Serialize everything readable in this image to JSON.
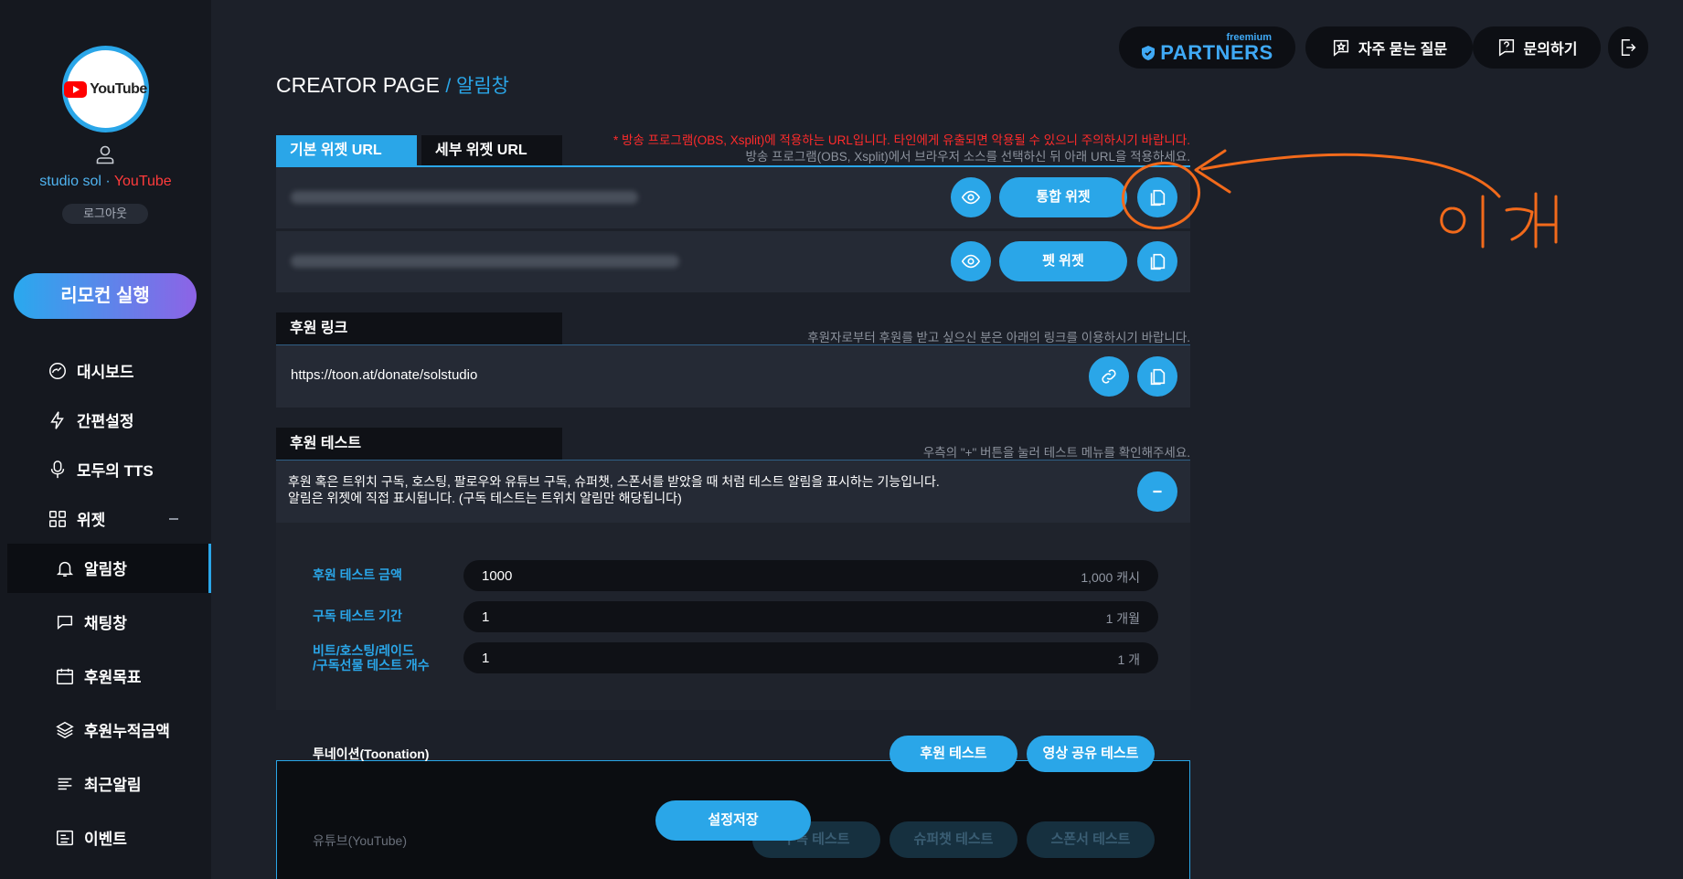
{
  "colors": {
    "accent": "#2aa6e8",
    "warning": "#ff2b2b",
    "annotation": "#f26a1b"
  },
  "sidebar": {
    "avatar_logo_text": "YouTube",
    "user": {
      "name": "studio sol",
      "separator": " · ",
      "platform": "YouTube"
    },
    "logout_label": "로그아웃",
    "remote_label": "리모컨 실행",
    "items": [
      {
        "label": "대시보드",
        "icon": "dashboard-icon"
      },
      {
        "label": "간편설정",
        "icon": "lightning-icon"
      },
      {
        "label": "모두의 TTS",
        "icon": "microphone-icon"
      },
      {
        "label": "위젯",
        "icon": "widget-icon"
      },
      {
        "label": "알림창",
        "icon": "bell-icon"
      },
      {
        "label": "채팅창",
        "icon": "chat-icon"
      },
      {
        "label": "후원목표",
        "icon": "calendar-icon"
      },
      {
        "label": "후원누적금액",
        "icon": "layers-icon"
      },
      {
        "label": "최근알림",
        "icon": "list-icon"
      },
      {
        "label": "이벤트",
        "icon": "event-icon"
      }
    ]
  },
  "topbar": {
    "partners_tier": "freemium",
    "partners_label": "PARTNERS",
    "faq_label": "자주 묻는 질문",
    "contact_label": "문의하기"
  },
  "page": {
    "title": "CREATOR PAGE",
    "subtitle": "/ 알림창"
  },
  "widget_url": {
    "tabs": [
      "기본 위젯 URL",
      "세부 위젯 URL"
    ],
    "warning": "* 방송 프로그램(OBS, Xsplit)에 적용하는 URL입니다. 타인에게 유출되면 악용될 수 있으니 주의하시기 바랍니다.",
    "instruction": "방송 프로그램(OBS, Xsplit)에서 브라우저 소스를 선택하신 뒤 아래 URL을 적용하세요.",
    "rows": [
      {
        "button_label": "통합 위젯"
      },
      {
        "button_label": "펫 위젯"
      }
    ]
  },
  "donate_link": {
    "title": "후원 링크",
    "note": "후원자로부터 후원를 받고 싶으신 분은 아래의 링크를 이용하시기 바랍니다.",
    "url": "https://toon.at/donate/solstudio"
  },
  "donate_test": {
    "title": "후원 테스트",
    "note": "우측의 \"+\" 버튼을 눌러 테스트 메뉴를 확인해주세요.",
    "desc_line1": "후원 혹은 트위치 구독, 호스팅, 팔로우와 유튜브 구독, 슈퍼챗, 스폰서를 받았을 때 처럼 테스트 알림을 표시하는 기능입니다.",
    "desc_line2": "알림은 위젯에 직접 표시됩니다. (구독 테스트는 트위치 알림만 해당됩니다)",
    "fields": [
      {
        "label": "후원 테스트 금액",
        "value": "1000",
        "unit": "1,000 캐시"
      },
      {
        "label": "구독 테스트 기간",
        "value": "1",
        "unit": "1 개월"
      },
      {
        "label_line1": "비트/호스팅/레이드",
        "label_line2": "/구독선물 테스트 개수",
        "value": "1",
        "unit": "1 개"
      }
    ],
    "toonation_label": "투네이션(Toonation)",
    "donate_test_btn": "후원 테스트",
    "video_share_btn": "영상 공유 테스트",
    "youtube_label": "유튜브(YouTube)",
    "sub_test_btn": "구독 테스트",
    "superchat_btn": "슈퍼챗 테스트",
    "sponsor_btn": "스폰서 테스트"
  },
  "save_label": "설정저장"
}
